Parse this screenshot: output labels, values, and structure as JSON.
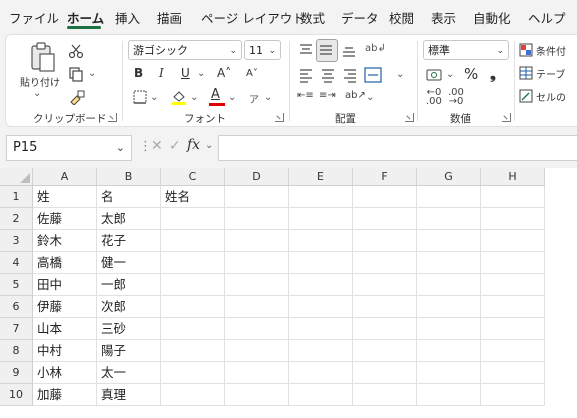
{
  "menu": {
    "items": [
      "ファイル",
      "ホーム",
      "挿入",
      "描画",
      "ページ レイアウト",
      "数式",
      "データ",
      "校閲",
      "表示",
      "自動化",
      "ヘルプ"
    ],
    "active_index": 1
  },
  "ribbon": {
    "clipboard": {
      "paste_label": "貼り付け",
      "group_label": "クリップボード"
    },
    "font": {
      "font_name": "游ゴシック",
      "font_size": "11",
      "bold": "B",
      "italic": "I",
      "underline": "U",
      "grow": "A˄",
      "shrink": "A˅",
      "group_label": "フォント"
    },
    "alignment": {
      "group_label": "配置"
    },
    "number": {
      "format": "標準",
      "percent": "%",
      "comma": "❟",
      "group_label": "数値"
    },
    "styles": {
      "conditional": "条件付",
      "table": "テーブ",
      "cell": "セルの"
    }
  },
  "formula_bar": {
    "name_box": "P15",
    "fx": "fx",
    "formula": ""
  },
  "grid": {
    "columns": [
      "A",
      "B",
      "C",
      "D",
      "E",
      "F",
      "G",
      "H"
    ],
    "rows": [
      {
        "n": "1",
        "a": "姓",
        "b": "名",
        "c": "姓名"
      },
      {
        "n": "2",
        "a": "佐藤",
        "b": "太郎",
        "c": ""
      },
      {
        "n": "3",
        "a": "鈴木",
        "b": "花子",
        "c": ""
      },
      {
        "n": "4",
        "a": "高橋",
        "b": "健一",
        "c": ""
      },
      {
        "n": "5",
        "a": "田中",
        "b": "一郎",
        "c": ""
      },
      {
        "n": "6",
        "a": "伊藤",
        "b": "次郎",
        "c": ""
      },
      {
        "n": "7",
        "a": "山本",
        "b": "三砂",
        "c": ""
      },
      {
        "n": "8",
        "a": "中村",
        "b": "陽子",
        "c": ""
      },
      {
        "n": "9",
        "a": "小林",
        "b": "太一",
        "c": ""
      },
      {
        "n": "10",
        "a": "加藤",
        "b": "真理",
        "c": ""
      }
    ]
  },
  "colors": {
    "accent": "#1e7145",
    "font_color": "#e00000",
    "highlight": "#ffff00"
  }
}
